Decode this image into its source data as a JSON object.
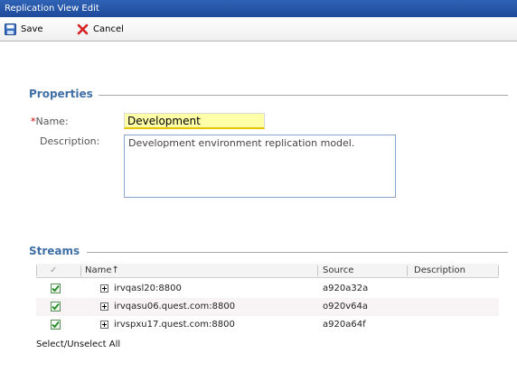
{
  "window": {
    "title": "Replication View Edit"
  },
  "toolbar": {
    "save_label": "Save",
    "cancel_label": "Cancel"
  },
  "properties": {
    "section_title": "Properties",
    "name_required_mark": "*",
    "name_label": "Name:",
    "name_value": "Development",
    "description_label": "Description:",
    "description_value": "Development environment replication model."
  },
  "streams": {
    "section_title": "Streams",
    "columns": {
      "check": "✓",
      "name": "Name↑",
      "source": "Source",
      "description": "Description"
    },
    "rows": [
      {
        "checked": true,
        "name": "irvqasl20:8800",
        "source": "a920a32a",
        "description": ""
      },
      {
        "checked": true,
        "name": "irvqasu06.quest.com:8800",
        "source": "o920v64a",
        "description": ""
      },
      {
        "checked": true,
        "name": "irvspxu17.quest.com:8800",
        "source": "a920a64f",
        "description": ""
      }
    ],
    "select_all_label": "Select/Unselect All"
  },
  "colors": {
    "titlebar": "#2f63b5",
    "section_title": "#3f6fa6",
    "name_highlight": "#ffffa8",
    "required": "#cc0000"
  },
  "icons": {
    "save": "floppy-disk-icon",
    "cancel": "red-x-icon",
    "expand": "plus-box-icon",
    "check": "checkmark-icon"
  }
}
